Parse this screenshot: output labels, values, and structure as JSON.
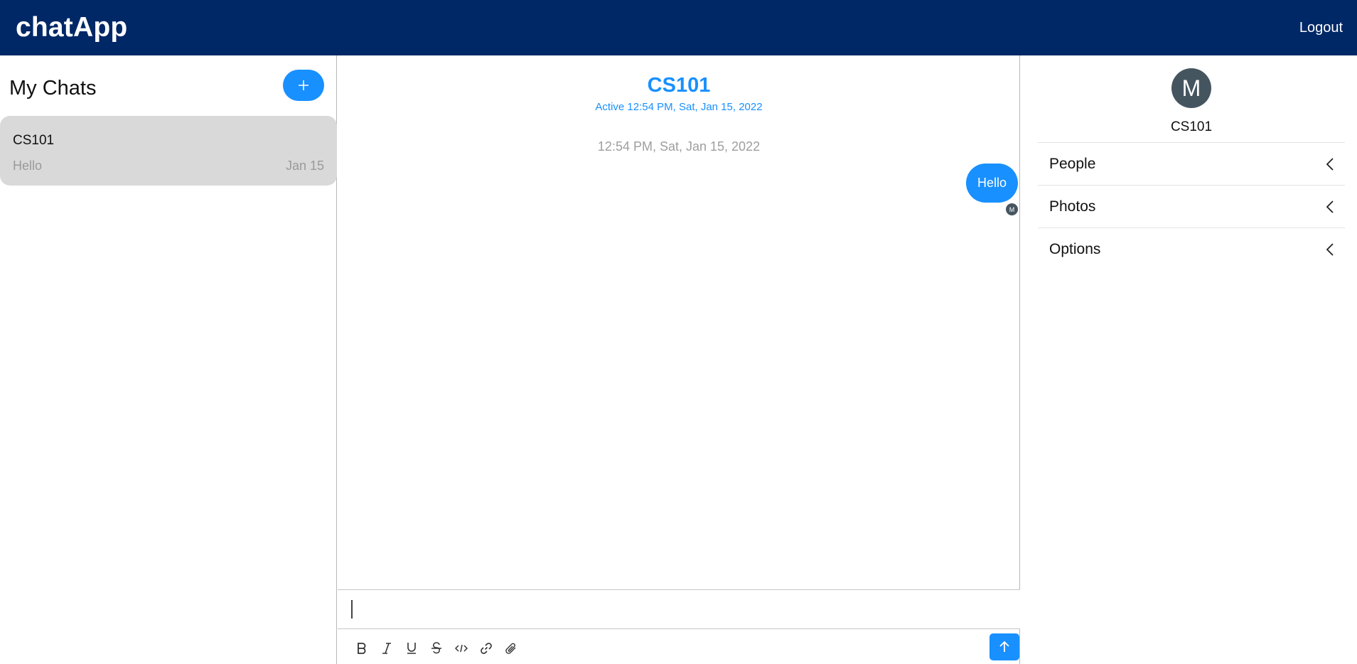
{
  "header": {
    "brand": "chatApp",
    "logout_label": "Logout",
    "color": "#002766"
  },
  "sidebar": {
    "title": "My Chats",
    "new_chat_icon": "plus-icon",
    "chats": [
      {
        "name": "CS101",
        "preview": "Hello",
        "date": "Jan 15",
        "selected": true
      }
    ]
  },
  "conversation": {
    "title": "CS101",
    "active_text": "Active 12:54 PM, Sat, Jan 15, 2022",
    "messages": [
      {
        "timestamp": "12:54 PM, Sat, Jan 15, 2022",
        "text": "Hello",
        "from_me": true,
        "read_by_initial": "M"
      }
    ],
    "composer": {
      "value": "",
      "tools": [
        "bold-icon",
        "italic-icon",
        "underline-icon",
        "strikethrough-icon",
        "code-icon",
        "link-icon",
        "attachment-icon"
      ],
      "send_icon": "arrow-up-icon"
    }
  },
  "details": {
    "avatar_initial": "M",
    "name": "CS101",
    "sections": [
      {
        "label": "People"
      },
      {
        "label": "Photos"
      },
      {
        "label": "Options"
      }
    ]
  },
  "colors": {
    "accent": "#1890ff",
    "selected_bg": "#d9d9d9",
    "avatar_bg": "#455560"
  }
}
